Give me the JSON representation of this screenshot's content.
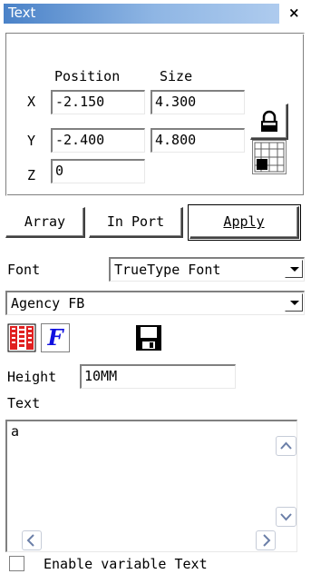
{
  "window": {
    "title": "Text",
    "close_glyph": "×"
  },
  "transform": {
    "position_header": "Position",
    "size_header": "Size",
    "x_label": "X",
    "y_label": "Y",
    "z_label": "Z",
    "x_position": "-2.150",
    "x_size": "4.300",
    "y_position": "-2.400",
    "y_size": "4.800",
    "z_value": "0",
    "lock_icon": "padlock-icon",
    "grid_icon": "grid-origin-icon"
  },
  "actions": {
    "array_label": "Array",
    "import_label": "In Port",
    "apply_label": "Apply"
  },
  "font": {
    "label": "Font",
    "type_selected": "TrueType Font",
    "family_selected": "Agency FB"
  },
  "tools": {
    "icon1": "barcode-settings-icon",
    "icon2": "font-style-icon",
    "icon2_glyph": "F",
    "icon3": "save-icon"
  },
  "height": {
    "label": "Height",
    "value": "10MM"
  },
  "text": {
    "label": "Text",
    "content": "a"
  },
  "variable": {
    "label": "Enable variable Text",
    "checked": false
  },
  "colors": {
    "title_start": "#4a82c8",
    "title_end": "#aecbee",
    "accent_blue": "#1010e0",
    "barcode_red": "#e02020"
  }
}
